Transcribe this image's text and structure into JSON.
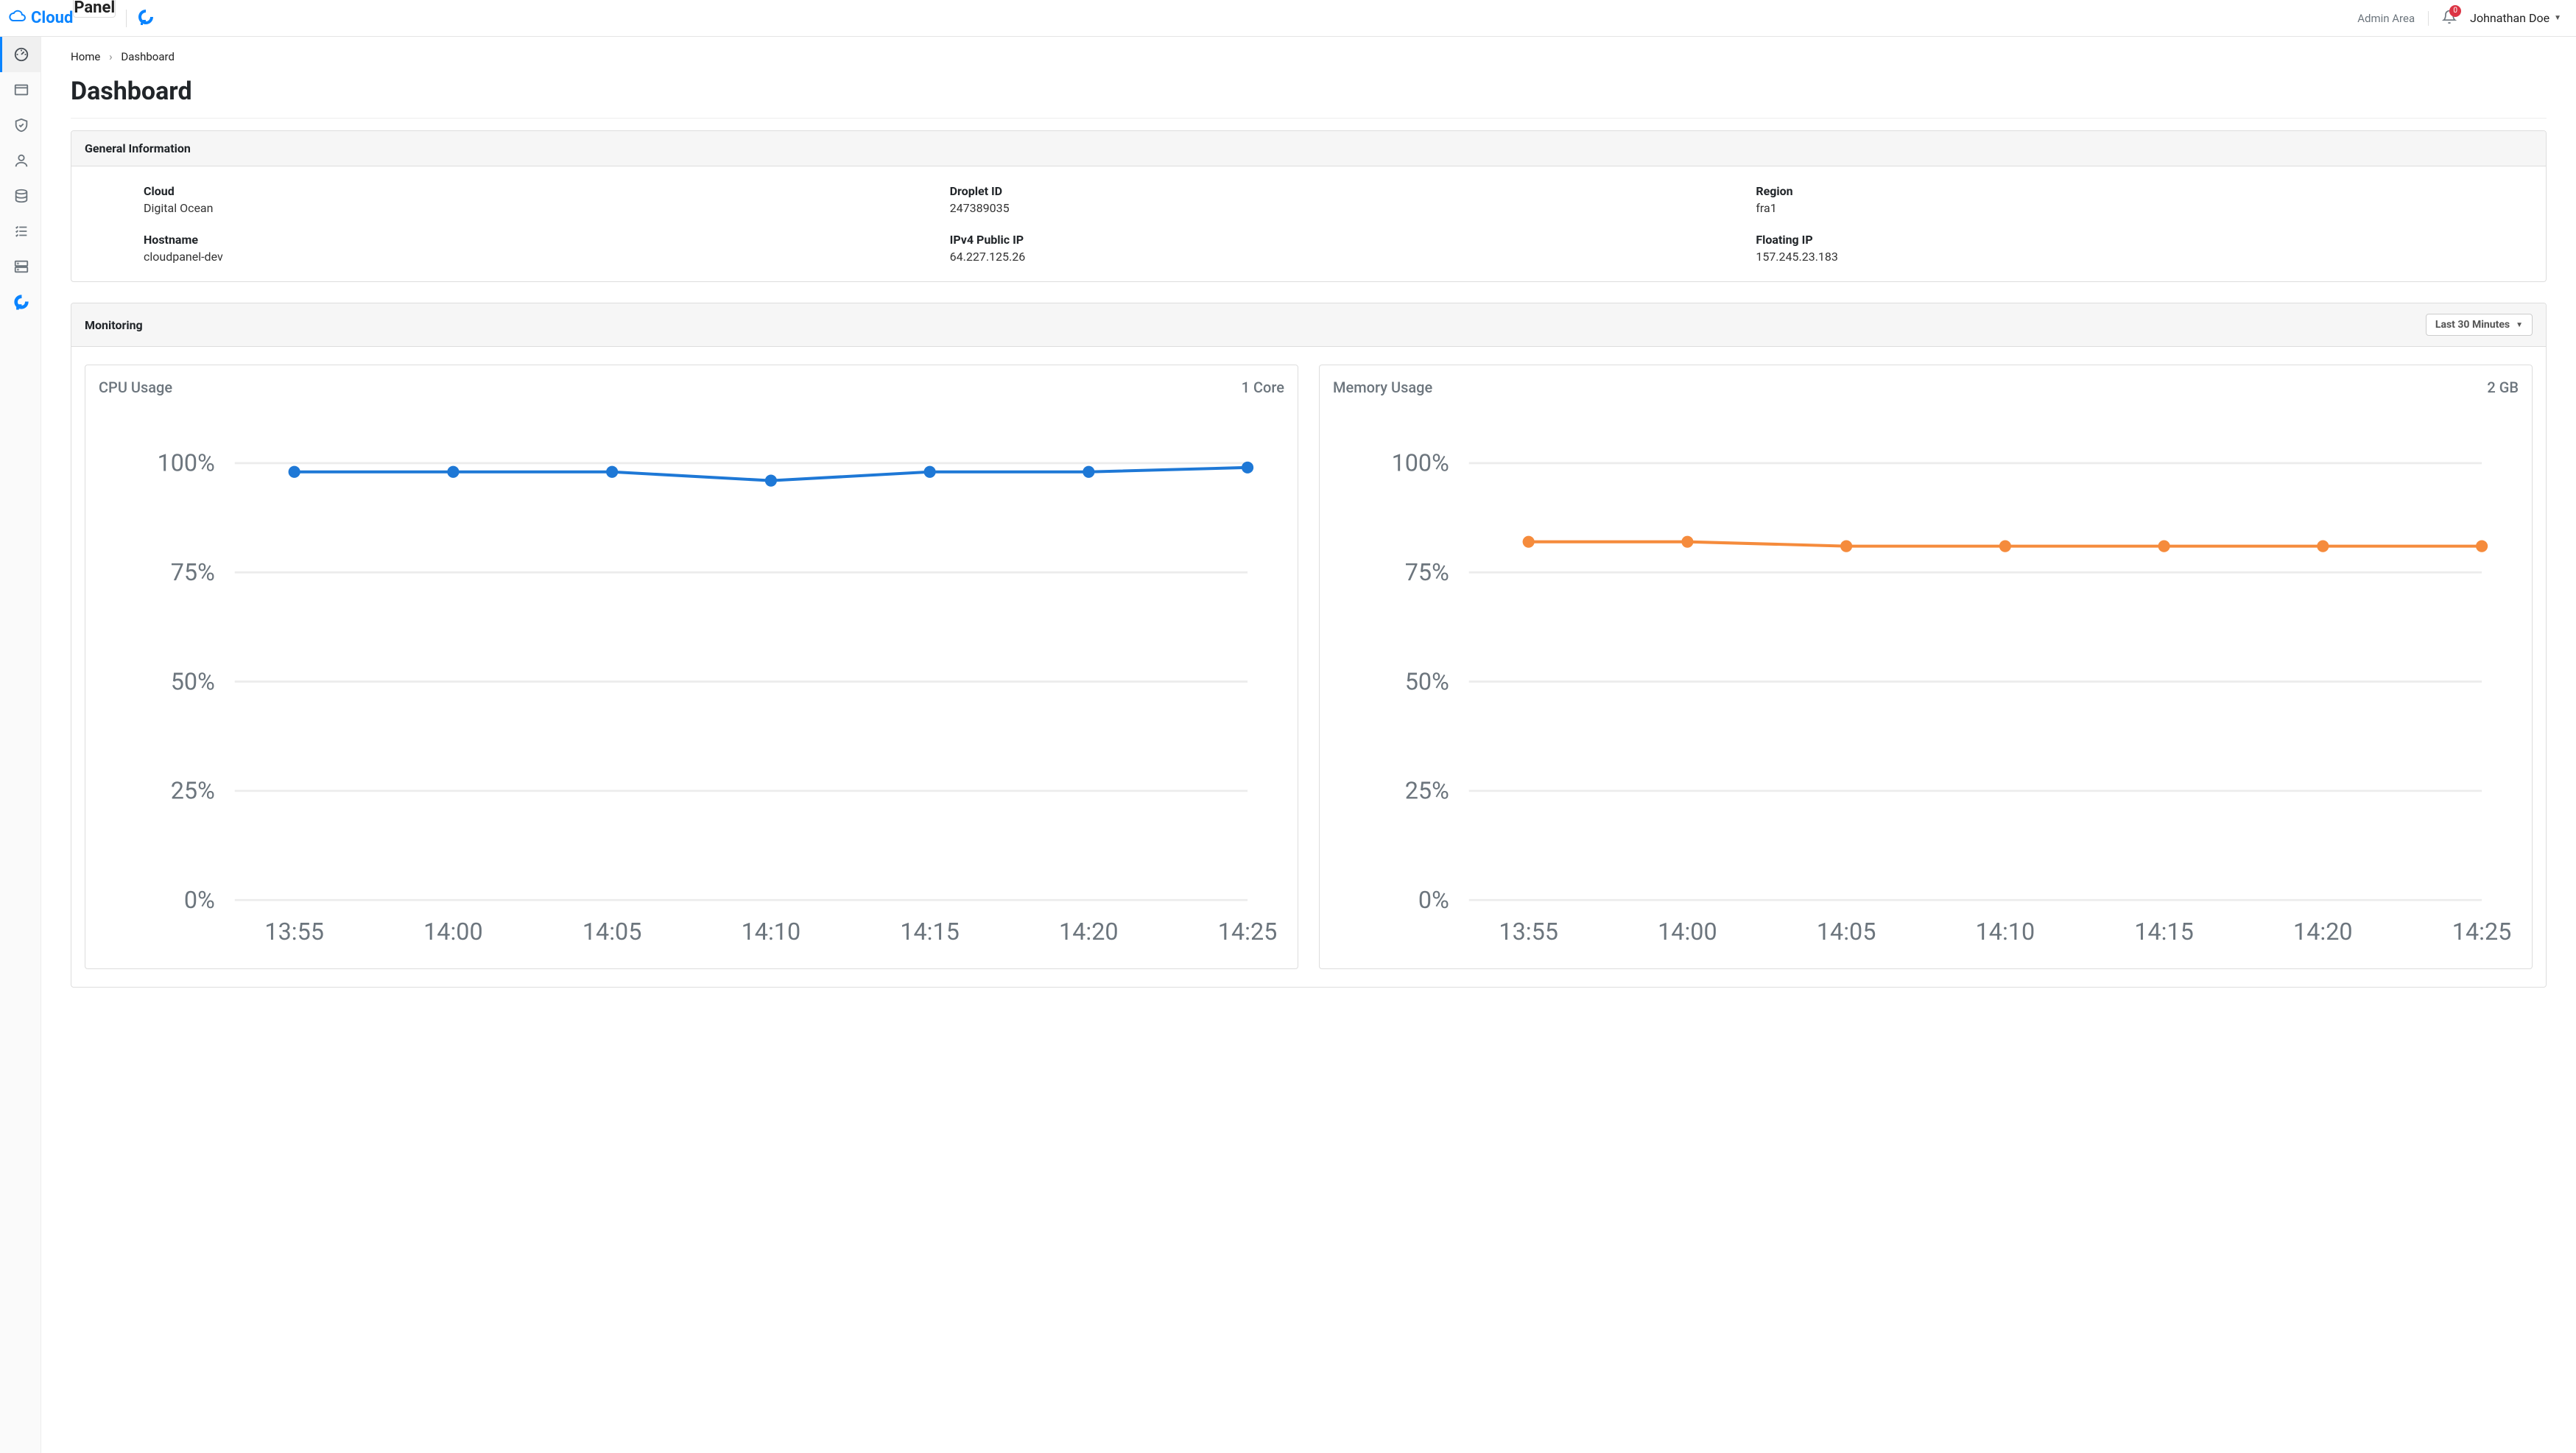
{
  "header": {
    "brand_cloud": "Cloud",
    "brand_panel": "Panel",
    "admin_area_label": "Admin Area",
    "notification_count": "0",
    "user_name": "Johnathan Doe"
  },
  "breadcrumb": {
    "home": "Home",
    "current": "Dashboard"
  },
  "page": {
    "title": "Dashboard"
  },
  "general_info": {
    "title": "General Information",
    "items": [
      {
        "label": "Cloud",
        "value": "Digital Ocean"
      },
      {
        "label": "Droplet ID",
        "value": "247389035"
      },
      {
        "label": "Region",
        "value": "fra1"
      },
      {
        "label": "Hostname",
        "value": "cloudpanel-dev"
      },
      {
        "label": "IPv4 Public IP",
        "value": "64.227.125.26"
      },
      {
        "label": "Floating IP",
        "value": "157.245.23.183"
      }
    ]
  },
  "monitoring": {
    "title": "Monitoring",
    "range_label": "Last 30 Minutes",
    "charts": {
      "cpu": {
        "title": "CPU Usage",
        "subtitle": "1 Core"
      },
      "memory": {
        "title": "Memory Usage",
        "subtitle": "2 GB"
      }
    }
  },
  "chart_data": [
    {
      "type": "line",
      "title": "CPU Usage",
      "subtitle": "1 Core",
      "ylabel": "",
      "xlabel": "",
      "ylim": [
        0,
        100
      ],
      "y_ticks": [
        "0%",
        "25%",
        "50%",
        "75%",
        "100%"
      ],
      "categories": [
        "13:55",
        "14:00",
        "14:05",
        "14:10",
        "14:15",
        "14:20",
        "14:25"
      ],
      "series": [
        {
          "name": "CPU",
          "color": "#1e78d6",
          "values": [
            98,
            98,
            98,
            96,
            98,
            98,
            99
          ]
        }
      ]
    },
    {
      "type": "line",
      "title": "Memory Usage",
      "subtitle": "2 GB",
      "ylabel": "",
      "xlabel": "",
      "ylim": [
        0,
        100
      ],
      "y_ticks": [
        "0%",
        "25%",
        "50%",
        "75%",
        "100%"
      ],
      "categories": [
        "13:55",
        "14:00",
        "14:05",
        "14:10",
        "14:15",
        "14:20",
        "14:25"
      ],
      "series": [
        {
          "name": "Memory",
          "color": "#f58b3c",
          "values": [
            82,
            82,
            81,
            81,
            81,
            81,
            81
          ]
        }
      ]
    }
  ],
  "colors": {
    "primary": "#0a84ff",
    "cpu_line": "#1e78d6",
    "memory_line": "#f58b3c",
    "danger": "#dc3545"
  }
}
